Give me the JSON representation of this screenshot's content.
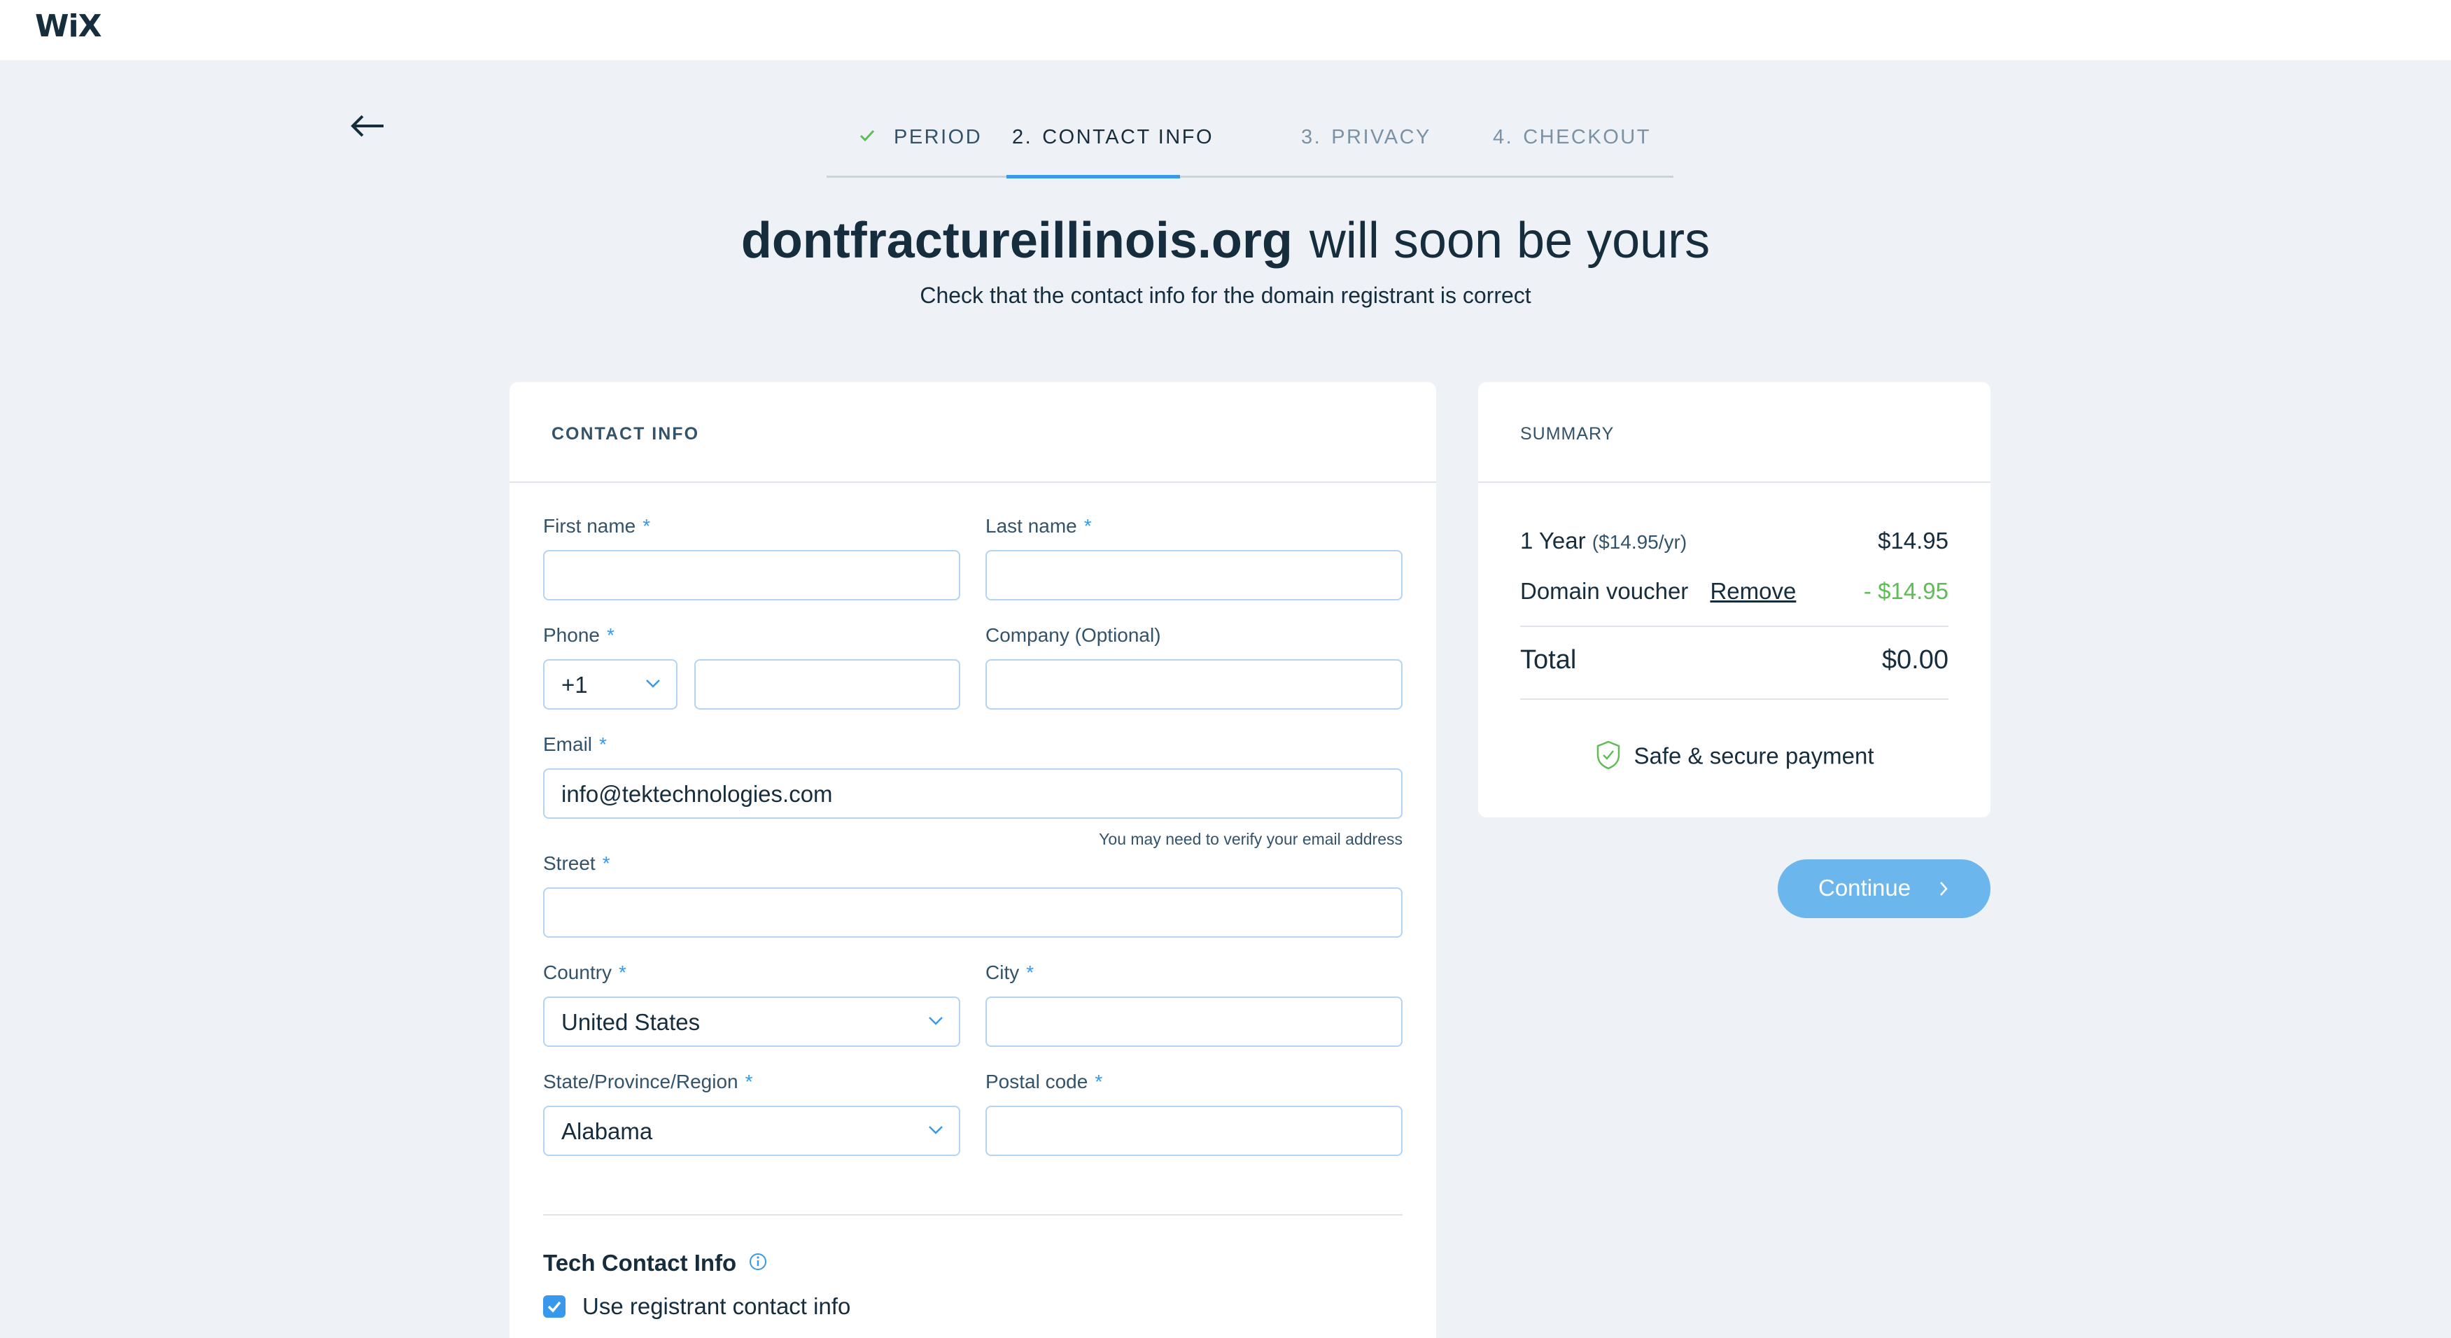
{
  "brand": {
    "logo_text": "WiX"
  },
  "steps": [
    {
      "label": "PERIOD",
      "number": "",
      "state": "done"
    },
    {
      "label": "CONTACT INFO",
      "number": "2.",
      "state": "active"
    },
    {
      "label": "PRIVACY",
      "number": "3.",
      "state": "upcoming"
    },
    {
      "label": "CHECKOUT",
      "number": "4.",
      "state": "upcoming"
    }
  ],
  "headline": {
    "domain": "dontfractureillinois.org",
    "suffix": "will soon be yours",
    "subtitle": "Check that the contact info for the domain registrant is correct"
  },
  "contact": {
    "title": "CONTACT INFO",
    "required_mark": "*",
    "first_name": {
      "label": "First name",
      "value": ""
    },
    "last_name": {
      "label": "Last name",
      "value": ""
    },
    "phone": {
      "label": "Phone",
      "code": "+1",
      "value": ""
    },
    "company": {
      "label": "Company (Optional)",
      "value": ""
    },
    "email": {
      "label": "Email",
      "value": "info@tektechnologies.com",
      "hint": "You may need to verify your email address"
    },
    "street": {
      "label": "Street",
      "value": ""
    },
    "country": {
      "label": "Country",
      "value": "United States"
    },
    "city": {
      "label": "City",
      "value": ""
    },
    "state": {
      "label": "State/Province/Region",
      "value": "Alabama"
    },
    "postal": {
      "label": "Postal code",
      "value": ""
    },
    "tech_title": "Tech Contact Info",
    "use_registrant_label": "Use registrant contact info",
    "use_registrant_checked": true
  },
  "summary": {
    "title": "SUMMARY",
    "period_label": "1 Year",
    "period_rate": "($14.95/yr)",
    "period_price": "$14.95",
    "voucher_label": "Domain voucher",
    "remove_label": "Remove",
    "voucher_amount": "- $14.95",
    "total_label": "Total",
    "total_value": "$0.00",
    "secure_text": "Safe & secure payment"
  },
  "continue_label": "Continue",
  "colors": {
    "accent": "#3899ec",
    "success": "#60bc57",
    "button": "#6bb6ec",
    "text": "#162d3d"
  },
  "icons": [
    "back-arrow-icon",
    "check-icon",
    "chevron-down-icon",
    "info-icon",
    "checkbox-check-icon",
    "shield-check-icon",
    "chevron-right-icon"
  ]
}
